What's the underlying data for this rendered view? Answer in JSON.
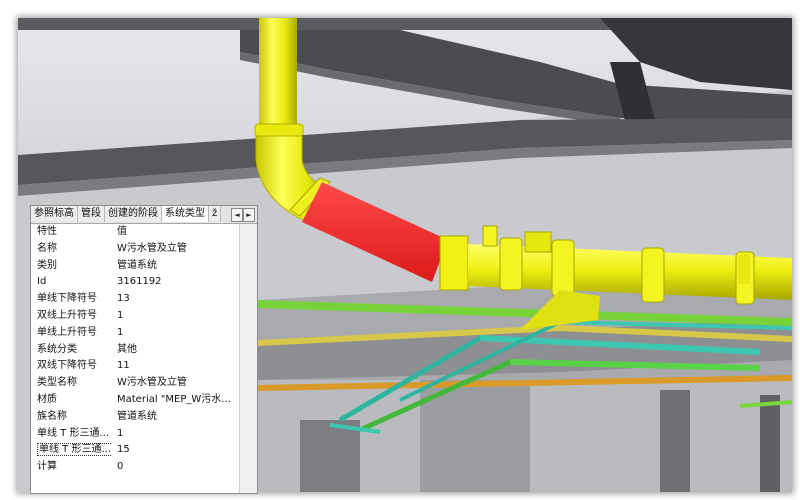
{
  "tabs": [
    {
      "label": "参照标高",
      "active": false
    },
    {
      "label": "管段",
      "active": false
    },
    {
      "label": "创建的阶段",
      "active": false
    },
    {
      "label": "系统类型",
      "active": true
    },
    {
      "label": "ž",
      "active": false
    }
  ],
  "tab_scroll": {
    "left": "◄",
    "right": "►"
  },
  "properties_table": {
    "header": {
      "name": "特性",
      "value": "值"
    },
    "rows": [
      {
        "name": "名称",
        "value": "W污水管及立管"
      },
      {
        "name": "类别",
        "value": "管道系统"
      },
      {
        "name": "Id",
        "value": "3161192"
      },
      {
        "name": "单线下降符号",
        "value": "13"
      },
      {
        "name": "双线上升符号",
        "value": "1"
      },
      {
        "name": "单线上升符号",
        "value": "1"
      },
      {
        "name": "系统分类",
        "value": "其他"
      },
      {
        "name": "双线下降符号",
        "value": "11"
      },
      {
        "name": "类型名称",
        "value": "W污水管及立管"
      },
      {
        "name": "材质",
        "value": "Material \"MEP_W污水..."
      },
      {
        "name": "族名称",
        "value": "管道系统"
      },
      {
        "name": "单线 T 形三通...",
        "value": "1"
      },
      {
        "name": "单线 T 形三通...",
        "value": "15"
      },
      {
        "name": "计算",
        "value": "0"
      }
    ],
    "selected_row": 12
  },
  "colors": {
    "pipe_yellow": "#f2f20a",
    "pipe_selected_red": "#ee2222",
    "pipe_green": "#7ad63c",
    "pipe_teal": "#3cc8b0",
    "pipe_orange": "#d9a030",
    "panel_bg": "#ffffff"
  }
}
